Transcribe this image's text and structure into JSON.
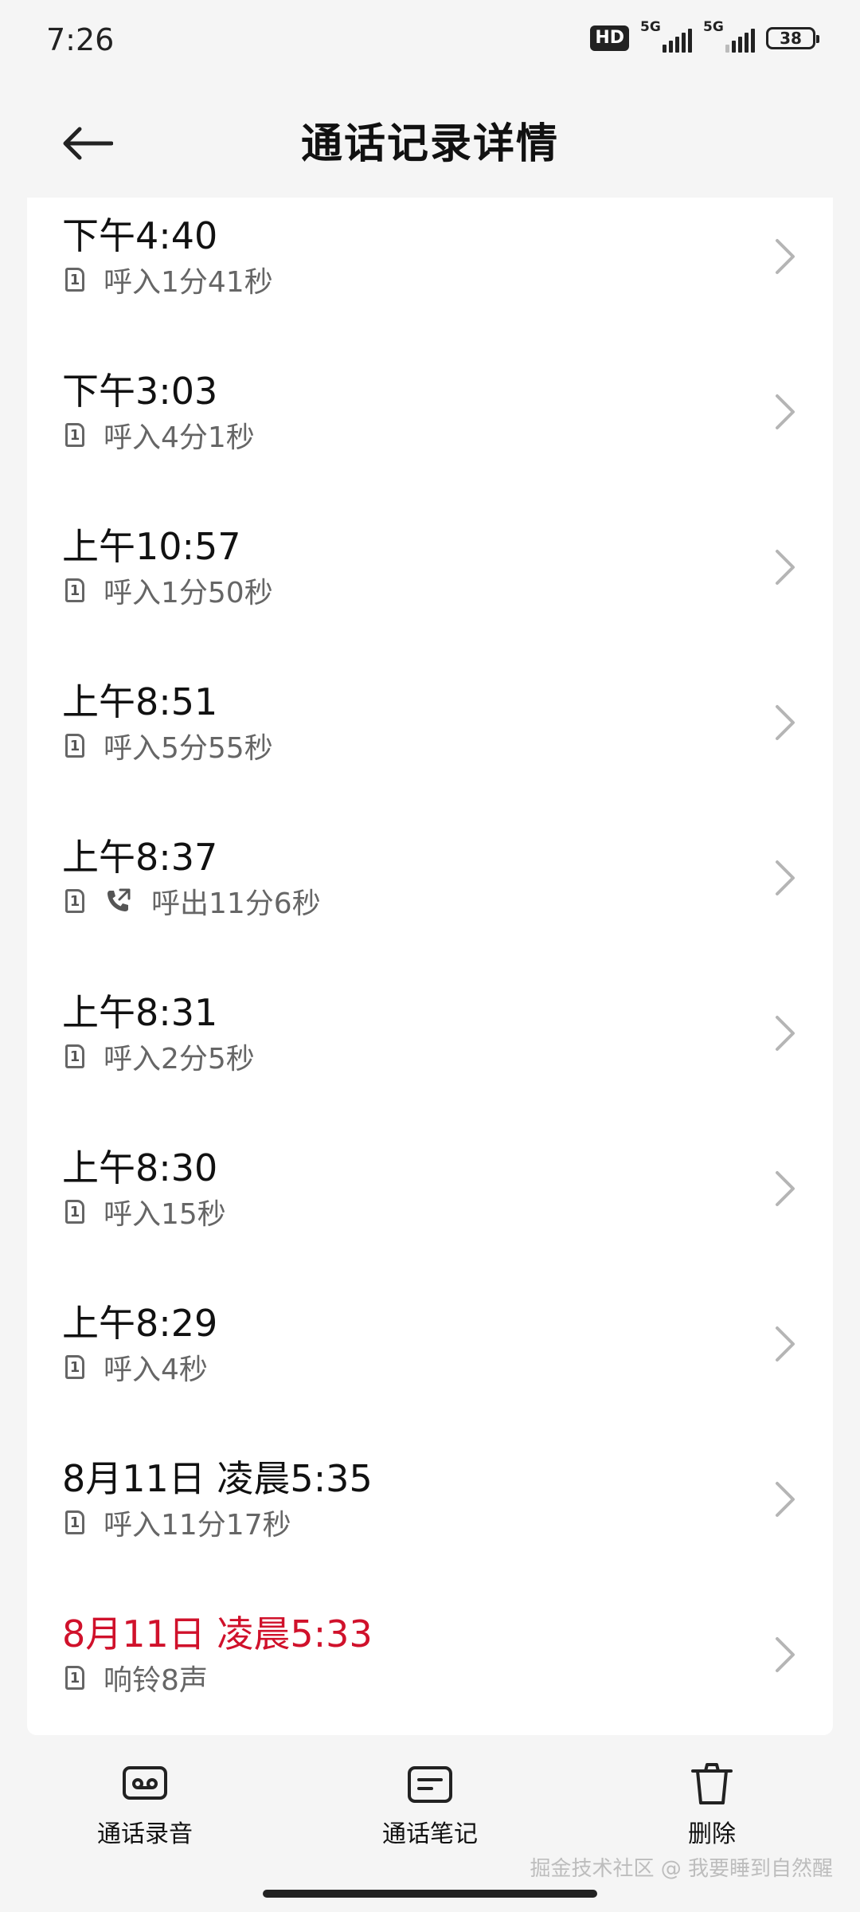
{
  "status_bar": {
    "time": "7:26",
    "hd": "HD",
    "network_1": "5G",
    "network_2": "5G",
    "battery": "38",
    "signal_1_icon": "signal-bars-icon",
    "signal_2_icon": "signal-bars-icon"
  },
  "header": {
    "title": "通话记录详情",
    "back_icon": "back-arrow-icon"
  },
  "calls": [
    {
      "time": "下午4:40",
      "sim": "1",
      "info": "呼入1分41秒",
      "direction": "incoming",
      "missed": false
    },
    {
      "time": "下午3:03",
      "sim": "1",
      "info": "呼入4分1秒",
      "direction": "incoming",
      "missed": false
    },
    {
      "time": "上午10:57",
      "sim": "1",
      "info": "呼入1分50秒",
      "direction": "incoming",
      "missed": false
    },
    {
      "time": "上午8:51",
      "sim": "1",
      "info": "呼入5分55秒",
      "direction": "incoming",
      "missed": false
    },
    {
      "time": "上午8:37",
      "sim": "1",
      "info": "呼出11分6秒",
      "direction": "outgoing",
      "missed": false
    },
    {
      "time": "上午8:31",
      "sim": "1",
      "info": "呼入2分5秒",
      "direction": "incoming",
      "missed": false
    },
    {
      "time": "上午8:30",
      "sim": "1",
      "info": "呼入15秒",
      "direction": "incoming",
      "missed": false
    },
    {
      "time": "上午8:29",
      "sim": "1",
      "info": "呼入4秒",
      "direction": "incoming",
      "missed": false
    },
    {
      "time": "8月11日 凌晨5:35",
      "sim": "1",
      "info": "呼入11分17秒",
      "direction": "incoming",
      "missed": false
    },
    {
      "time": "8月11日 凌晨5:33",
      "sim": "1",
      "info": "响铃8声",
      "direction": "incoming",
      "missed": true
    }
  ],
  "bottom_actions": [
    {
      "label": "通话录音",
      "icon": "recording-icon"
    },
    {
      "label": "通话笔记",
      "icon": "note-icon"
    },
    {
      "label": "删除",
      "icon": "trash-icon"
    }
  ],
  "watermark": "掘金技术社区 @ 我要睡到自然醒",
  "colors": {
    "missed": "#d0112b",
    "secondary_text": "#666666",
    "background": "#f5f5f5",
    "card": "#ffffff"
  }
}
